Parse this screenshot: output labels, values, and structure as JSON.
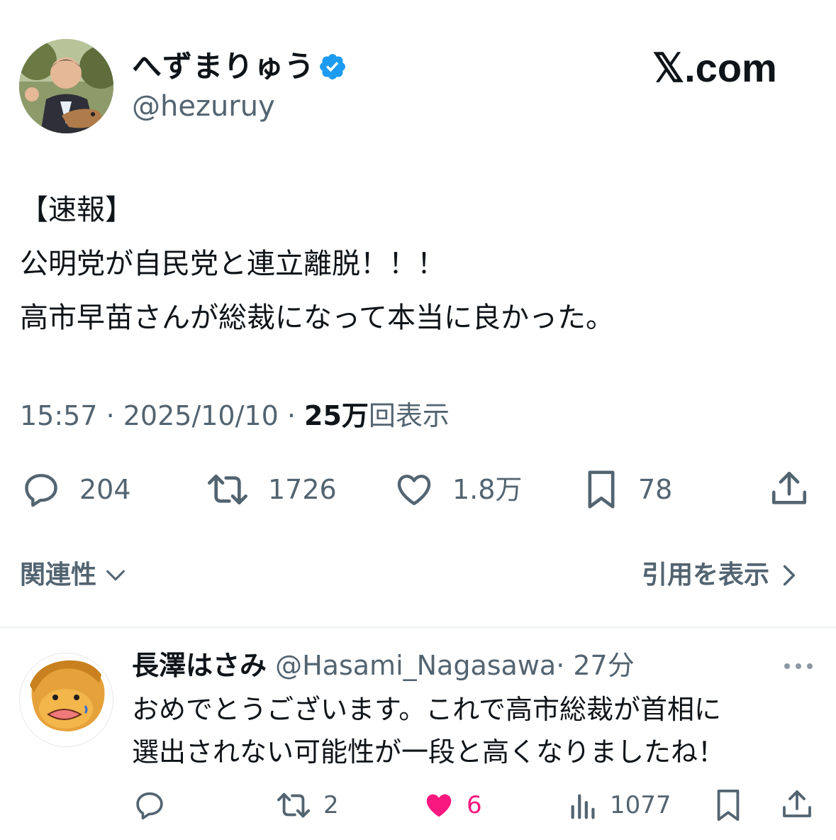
{
  "author": {
    "display_name": "へずまりゅう",
    "handle": "@hezuruy",
    "verified": true
  },
  "brand": "𝕏.com",
  "tweet": {
    "lines": [
      "【速報】",
      "公明党が自民党と連立離脱！！！",
      "高市早苗さんが総裁になって本当に良かった。"
    ],
    "time": "15:57 · 2025/10/10 · ",
    "views_number": "25万",
    "views_label": "回表示"
  },
  "actions": {
    "replies": "204",
    "retweets": "1726",
    "likes": "1.8万",
    "bookmarks": "78"
  },
  "footer": {
    "related": "関連性",
    "quotes": "引用を表示"
  },
  "reply": {
    "name": "長澤はさみ",
    "handle": "@Hasami_Nagasawa",
    "time": "· 27分",
    "lines": [
      "おめでとうございます。これで高市総裁が首相に",
      "選出されない可能性が一段と高くなりましたね！"
    ],
    "actions": {
      "retweets": "2",
      "likes": "6",
      "views": "1077"
    }
  },
  "colors": {
    "text": "#0f1419",
    "secondary": "#536471",
    "verified": "#1d9bf0",
    "like_active": "#f91880",
    "divider": "#eff3f4"
  }
}
